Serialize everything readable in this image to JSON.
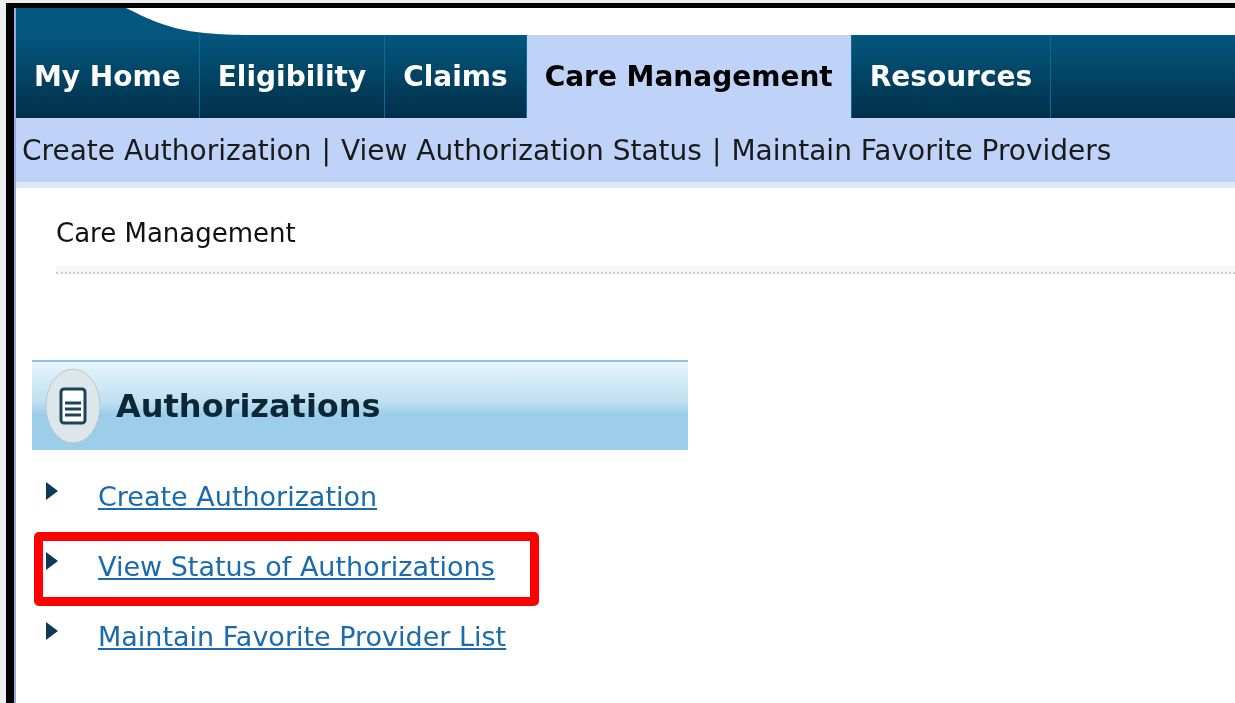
{
  "tabs": [
    {
      "label": "My Home",
      "selected": false
    },
    {
      "label": "Eligibility",
      "selected": false
    },
    {
      "label": "Claims",
      "selected": false
    },
    {
      "label": "Care Management",
      "selected": true
    },
    {
      "label": "Resources",
      "selected": false
    }
  ],
  "subnav": [
    "Create Authorization",
    "View Authorization Status",
    "Maintain Favorite Providers"
  ],
  "subnav_separator": "|",
  "breadcrumb": "Care Management",
  "panel": {
    "title": "Authorizations",
    "links": [
      {
        "label": "Create Authorization",
        "highlighted": false
      },
      {
        "label": "View Status of Authorizations",
        "highlighted": true
      },
      {
        "label": "Maintain Favorite Provider List",
        "highlighted": false
      }
    ]
  }
}
